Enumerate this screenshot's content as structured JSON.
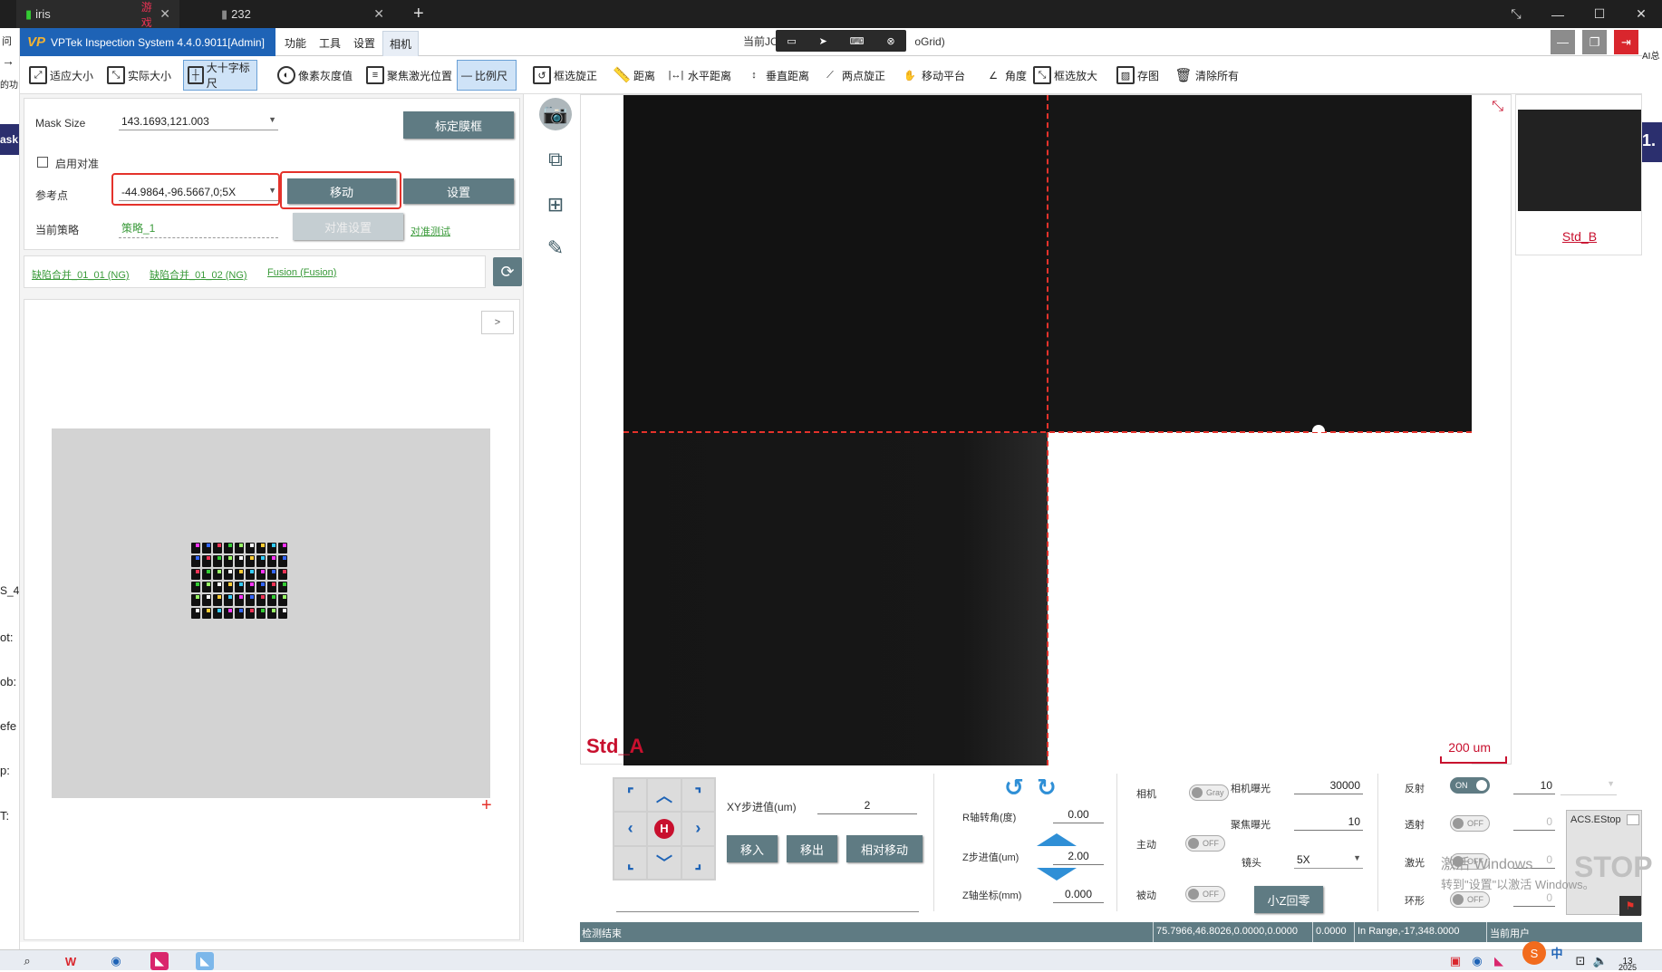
{
  "browser": {
    "tabs": [
      {
        "icon": "signal-icon",
        "title": "iris",
        "badge": "游戏"
      },
      {
        "icon": "signal-icon",
        "title": "232"
      }
    ],
    "new_tab": "+"
  },
  "left_strip": [
    "问",
    "→",
    "的功",
    "ask",
    "S_4.",
    "ot:",
    "ob:",
    "efe",
    "p:",
    "T:"
  ],
  "right_strip": [
    "AI总",
    "1."
  ],
  "app": {
    "title": "VPTek Inspection System 4.4.0.9011[Admin]",
    "logo": "VP",
    "menu": [
      "功能",
      "工具",
      "设置",
      "相机"
    ],
    "center_title_left": "当前JC",
    "center_title_right": "oGrid)"
  },
  "toolbar": [
    {
      "id": "fit",
      "label": "适应大小",
      "icon": "fit-icon"
    },
    {
      "id": "actual",
      "label": "实际大小",
      "icon": "actual-size-icon"
    },
    {
      "id": "crosshair",
      "label": "大十字标尺",
      "icon": "crosshair-icon",
      "active": true
    },
    {
      "id": "gray",
      "label": "像素灰度值",
      "icon": "gray-value-icon"
    },
    {
      "id": "laser",
      "label": "聚焦激光位置",
      "icon": "laser-icon"
    },
    {
      "id": "scale",
      "label": "比例尺",
      "icon": "scale-icon",
      "active": true
    },
    {
      "id": "rotate",
      "label": "框选旋正",
      "icon": "rotate-box-icon"
    },
    {
      "id": "distance",
      "label": "距离",
      "icon": "ruler-icon"
    },
    {
      "id": "hdist",
      "label": "水平距离",
      "icon": "horizontal-distance-icon"
    },
    {
      "id": "vdist",
      "label": "垂直距离",
      "icon": "vertical-distance-icon"
    },
    {
      "id": "tworotate",
      "label": "两点旋正",
      "icon": "two-point-icon"
    },
    {
      "id": "move",
      "label": "移动平台",
      "icon": "hand-icon"
    },
    {
      "id": "angle",
      "label": "角度",
      "icon": "angle-icon"
    },
    {
      "id": "zoom",
      "label": "框选放大",
      "icon": "zoom-box-icon"
    },
    {
      "id": "save",
      "label": "存图",
      "icon": "image-save-icon"
    },
    {
      "id": "clear",
      "label": "清除所有",
      "icon": "trash-icon"
    }
  ],
  "mask": {
    "mask_size_label": "Mask Size",
    "mask_size_value": "143.1693,121.003",
    "calibrate_btn": "标定膜框",
    "enable_align_label": "启用对准",
    "ref_label": "参考点",
    "ref_value": "-44.9864,-96.5667,0;5X",
    "move_btn": "移动",
    "set_btn": "设置",
    "strategy_label": "当前策略",
    "strategy_value": "策略_1",
    "align_set_btn": "对准设置",
    "align_test_link": "对准测试"
  },
  "fusion_links": [
    "缺陷合并_01_01 (NG)",
    "缺陷合并_01_02 (NG)",
    "Fusion (Fusion)"
  ],
  "map": {
    "expand": ">"
  },
  "viewer": {
    "label": "Std_A",
    "scale": "200 um",
    "thumb_label": "Std_B"
  },
  "controls": {
    "xy_step_label": "XY步进值(um)",
    "xy_step_value": "2",
    "move_in": "移入",
    "move_out": "移出",
    "relative_move": "相对移动",
    "r_angle_label": "R轴转角(度)",
    "r_angle_value": "0.00",
    "z_step_label": "Z步进值(um)",
    "z_step_value": "2.00",
    "z_coord_label": "Z轴坐标(mm)",
    "z_coord_value": "0.000",
    "camera_label": "相机",
    "camera_toggle": "Gray",
    "exposure_label": "相机曝光",
    "exposure_value": "30000",
    "focus_exposure_label": "聚焦曝光",
    "focus_exposure_value": "10",
    "active_label": "主动",
    "active_toggle": "OFF",
    "lens_label": "镜头",
    "lens_value": "5X",
    "passive_label": "被动",
    "passive_toggle": "OFF",
    "z_home_btn": "小Z回零",
    "reflect_label": "反射",
    "reflect_toggle": "ON",
    "reflect_value": "10",
    "transmit_label": "透射",
    "transmit_toggle": "OFF",
    "transmit_value": "0",
    "laser_label": "激光",
    "laser_toggle": "OFF",
    "laser_value": "0",
    "ring_label": "环形",
    "ring_toggle": "OFF",
    "ring_value": "0",
    "pad_home": "H"
  },
  "status": {
    "left": "检测结束",
    "coords": "75.7966,46.8026,0.0000,0.0000",
    "val": "0.0000",
    "range": "In Range,-17,348.0000",
    "user": "当前用户"
  },
  "estop": {
    "label": "ACS.EStop",
    "big": "STOP"
  },
  "watermark": {
    "line1": "激活 Windows",
    "line2": "转到\"设置\"以激活 Windows。"
  },
  "taskbar": {
    "ime": "中",
    "clock": "13",
    "year": "2025"
  },
  "colors": {
    "accent": "#1e63b6",
    "button": "#5f7b83",
    "highlight": "#e4322b",
    "label_red": "#c8102e",
    "link_green": "#3a9a3a"
  }
}
